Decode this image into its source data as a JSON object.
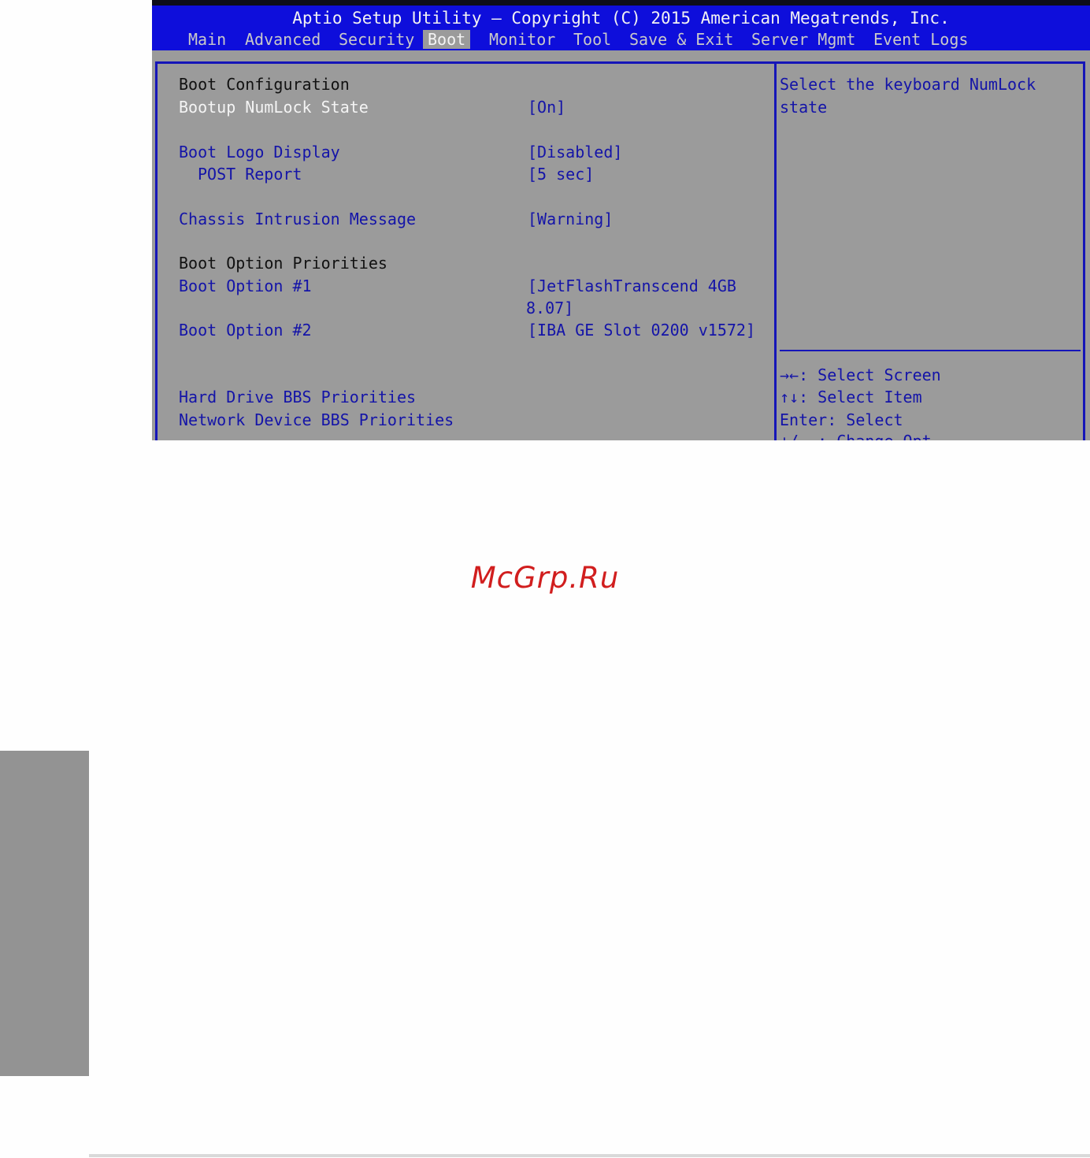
{
  "window": {
    "title": "Aptio Setup Utility – Copyright (C) 2015 American Megatrends, Inc."
  },
  "tabs": [
    {
      "label": "Main"
    },
    {
      "label": "Advanced"
    },
    {
      "label": "Security"
    },
    {
      "label": "Boot",
      "active": true
    },
    {
      "label": "Monitor"
    },
    {
      "label": "Tool"
    },
    {
      "label": "Save & Exit"
    },
    {
      "label": "Server Mgmt"
    },
    {
      "label": "Event Logs"
    }
  ],
  "settings": {
    "boot_configuration_header": "Boot Configuration",
    "bootup_numlock": {
      "label": "Bootup NumLock State",
      "value": "[On]"
    },
    "boot_logo_display": {
      "label": "Boot Logo Display",
      "value": "[Disabled]"
    },
    "post_report": {
      "label": "POST Report",
      "value": "[5 sec]"
    },
    "chassis_intrusion": {
      "label": "Chassis Intrusion Message",
      "value": "[Warning]"
    },
    "boot_option_priorities_header": "Boot Option Priorities",
    "boot_option_1": {
      "label": "Boot Option #1",
      "value_line1": "[JetFlashTranscend 4GB",
      "value_line2": "8.07]"
    },
    "boot_option_2": {
      "label": "Boot Option #2",
      "value": "[IBA GE Slot 0200 v1572]"
    },
    "hard_drive_bbs": {
      "label": "Hard Drive BBS Priorities"
    },
    "network_device_bbs": {
      "label": "Network Device BBS Priorities"
    }
  },
  "help_panel": {
    "description_line1": "Select the keyboard NumLock",
    "description_line2": "state",
    "keys": [
      "→←: Select Screen",
      "↑↓: Select Item",
      "Enter: Select",
      "+/- : Change Opt"
    ]
  },
  "page": {
    "watermark": "McGrp.Ru"
  },
  "colors": {
    "bios_blue": "#0e0edb",
    "bios_gray": "#9b9b9b",
    "item_blue": "#1414a8",
    "watermark_red": "#d11e1e"
  }
}
